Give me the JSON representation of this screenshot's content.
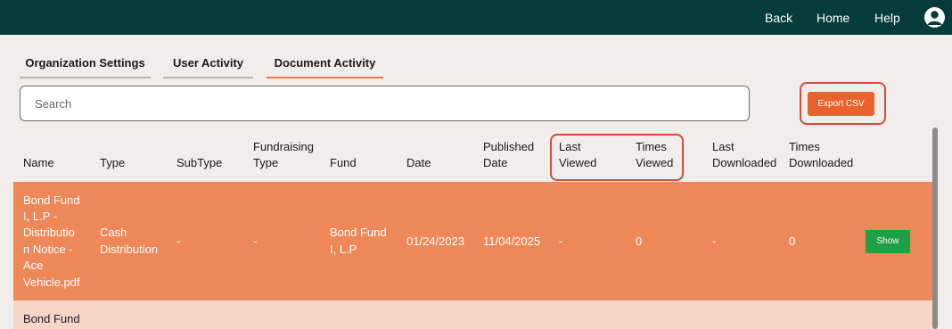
{
  "nav": {
    "back": "Back",
    "home": "Home",
    "help": "Help",
    "avatar_icon": "user-circle-icon"
  },
  "tabs": [
    {
      "label": "Organization Settings",
      "active": false
    },
    {
      "label": "User Activity",
      "active": false
    },
    {
      "label": "Document Activity",
      "active": true
    }
  ],
  "search": {
    "placeholder": "Search",
    "value": ""
  },
  "export_button": "Export CSV",
  "table": {
    "headers": [
      {
        "line1": "",
        "line2": "Name"
      },
      {
        "line1": "",
        "line2": "Type"
      },
      {
        "line1": "",
        "line2": "SubType"
      },
      {
        "line1": "Fundraising",
        "line2": "Type"
      },
      {
        "line1": "",
        "line2": "Fund"
      },
      {
        "line1": "",
        "line2": "Date"
      },
      {
        "line1": "Published",
        "line2": "Date"
      },
      {
        "line1": "Last",
        "line2": "Viewed"
      },
      {
        "line1": "Times",
        "line2": "Viewed"
      },
      {
        "line1": "Last",
        "line2": "Downloaded"
      },
      {
        "line1": "Times",
        "line2": "Downloaded"
      }
    ],
    "rows": [
      {
        "name_lines": [
          "Bond Fund",
          "I, L.P -",
          "Distributio",
          "n Notice -",
          "Ace",
          "Vehicle.pdf"
        ],
        "type_lines": [
          "Cash",
          "Distribution"
        ],
        "subtype": "-",
        "fundraising_type": "-",
        "fund_lines": [
          "Bond Fund",
          "I, L.P"
        ],
        "date": "01/24/2023",
        "published_date": "11/04/2025",
        "last_viewed": "-",
        "times_viewed": "0",
        "last_downloaded": "-",
        "times_downloaded": "0",
        "action": "Show"
      },
      {
        "name_lines": [
          "Bond Fund"
        ]
      }
    ]
  },
  "colors": {
    "topbar": "#053b3b",
    "accent": "#e8622e",
    "row_highlight": "#ee8859",
    "row_alt": "#f7d6c8",
    "annotation_ring": "#d84a3a",
    "show_button": "#1fa046"
  }
}
